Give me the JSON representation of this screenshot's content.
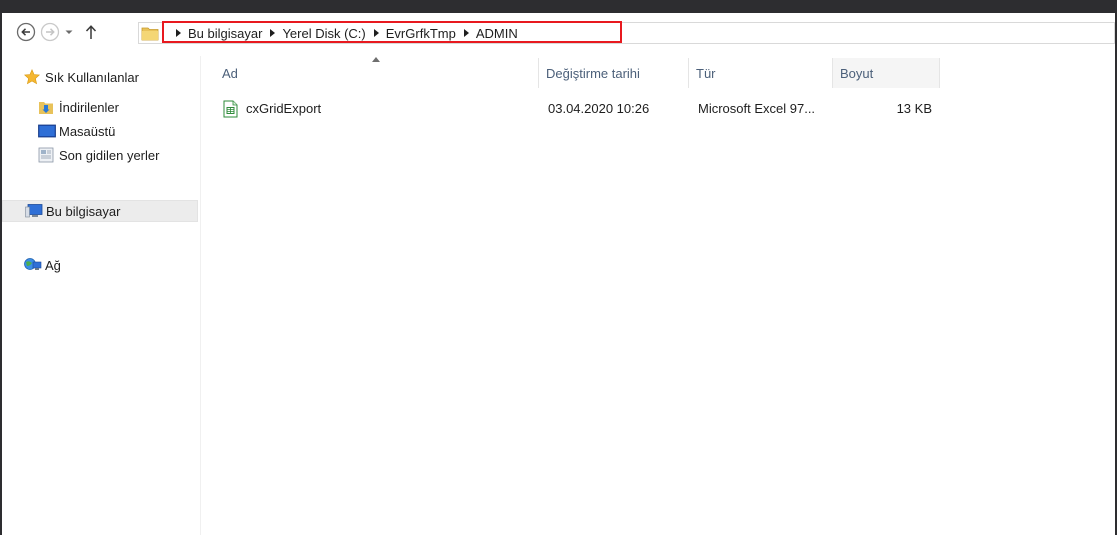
{
  "navigation": {
    "breadcrumb": [
      "Bu bilgisayar",
      "Yerel Disk (C:)",
      "EvrGrfkTmp",
      "ADMIN"
    ]
  },
  "sidebar": {
    "favorites": {
      "label": "Sık Kullanılanlar",
      "items": [
        {
          "label": "İndirilenler",
          "icon": "downloads-folder-icon"
        },
        {
          "label": "Masaüstü",
          "icon": "desktop-icon"
        },
        {
          "label": "Son gidilen yerler",
          "icon": "recent-places-icon"
        }
      ]
    },
    "computer": {
      "label": "Bu bilgisayar",
      "icon": "computer-icon"
    },
    "network": {
      "label": "Ağ",
      "icon": "network-icon"
    }
  },
  "columns": [
    {
      "label": "Ad"
    },
    {
      "label": "Değiştirme tarihi"
    },
    {
      "label": "Tür"
    },
    {
      "label": "Boyut"
    }
  ],
  "files": [
    {
      "name": "cxGridExport",
      "modified": "03.04.2020 10:26",
      "type": "Microsoft Excel 97...",
      "size": "13 KB",
      "icon": "excel-file-icon"
    }
  ],
  "colors": {
    "highlight_border": "#e8191f",
    "header_text": "#4c607a",
    "selected_bg": "#ececec"
  }
}
